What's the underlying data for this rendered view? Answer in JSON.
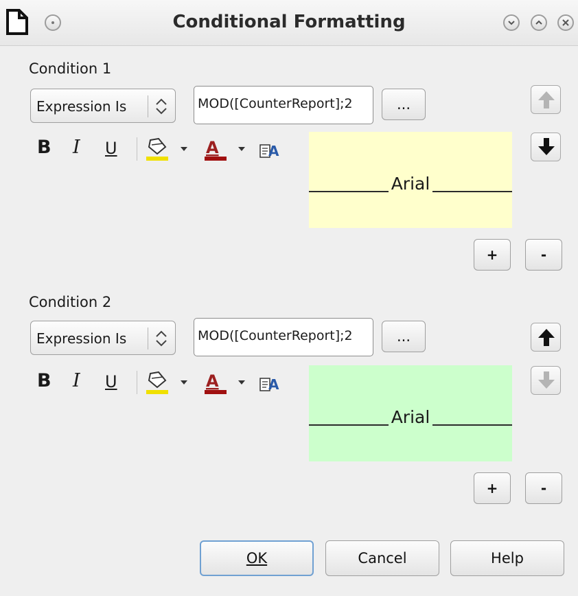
{
  "window": {
    "title": "Conditional Formatting"
  },
  "conditions": [
    {
      "label": "Condition 1",
      "type": "Expression Is",
      "expression": "MOD([CounterReport];2",
      "preview_text": "Arial",
      "preview_bg": "#ffffcc"
    },
    {
      "label": "Condition 2",
      "type": "Expression Is",
      "expression": "MOD([CounterReport];2",
      "preview_text": "Arial",
      "preview_bg": "#ccffcc"
    }
  ],
  "buttons": {
    "ellipsis": "...",
    "add": "+",
    "remove": "-",
    "ok": "OK",
    "cancel": "Cancel",
    "help": "Help"
  },
  "toolbar": {
    "bold": "B",
    "italic": "I",
    "underline": "U",
    "icons": [
      "background-color-icon",
      "font-color-icon",
      "font-dialog-icon"
    ]
  },
  "colors": {
    "highlight_yellow": "#f0e000",
    "font_red": "#a01010",
    "default_button_border": "#6fa0d2"
  }
}
